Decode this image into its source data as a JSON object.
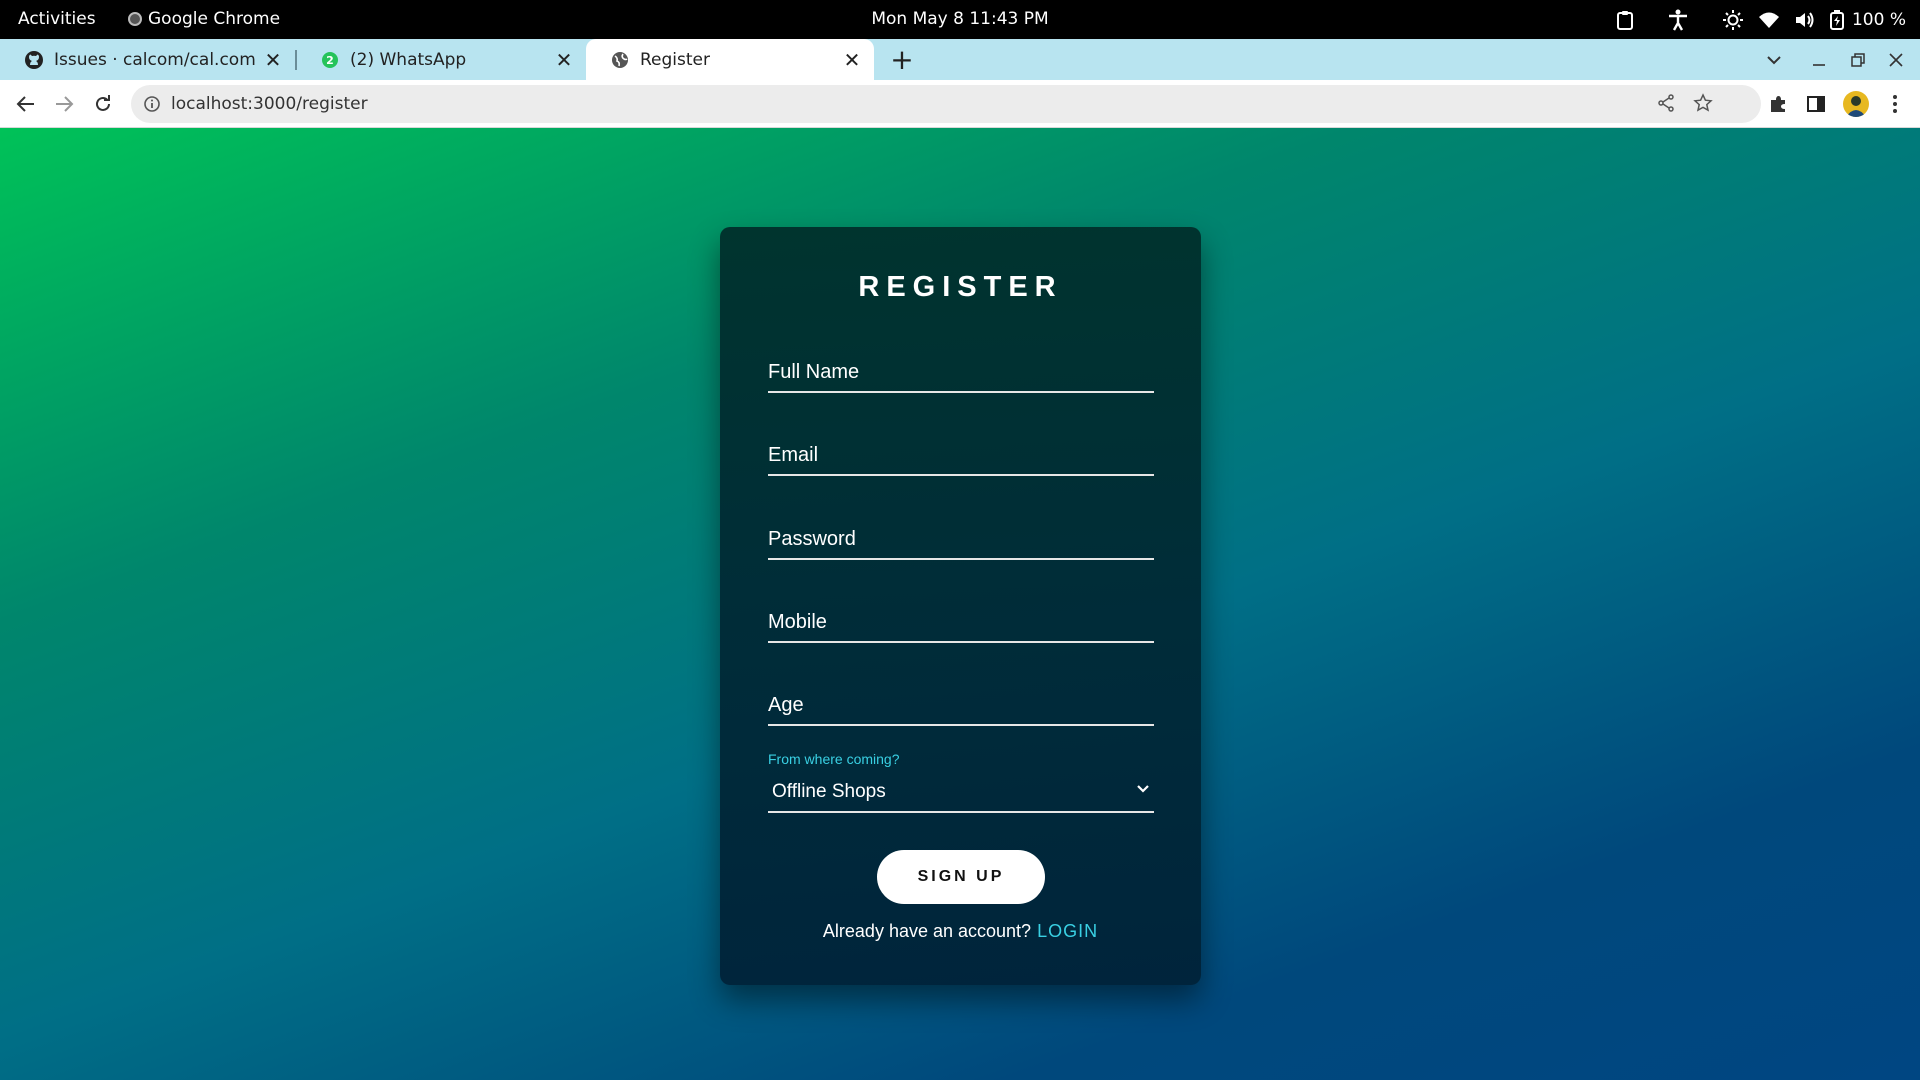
{
  "system_bar": {
    "activities": "Activities",
    "app_name": "Google Chrome",
    "clock": "Mon May 8  11:43 PM",
    "battery": "100 %"
  },
  "browser": {
    "tabs": [
      {
        "title": "Issues · calcom/cal.com · G",
        "icon": "github-icon",
        "active": false
      },
      {
        "title": "(2) WhatsApp",
        "icon": "whatsapp-icon",
        "badge": "2",
        "active": false
      },
      {
        "title": "Register",
        "icon": "globe-icon",
        "active": true
      }
    ],
    "url": "localhost:3000/register"
  },
  "register_form": {
    "title": "REGISTER",
    "fields": {
      "full_name": "Full Name",
      "email": "Email",
      "password": "Password",
      "mobile": "Mobile",
      "age": "Age"
    },
    "source_select": {
      "label": "From where coming?",
      "value": "Offline Shops"
    },
    "signup_label": "SIGN UP",
    "already_text": "Already have an account?",
    "login_link": "LOGIN"
  },
  "colors": {
    "accent": "#39d0e3",
    "gradient_start": "#00c258",
    "gradient_end": "#004682",
    "tabstrip": "#b8e4f0"
  }
}
